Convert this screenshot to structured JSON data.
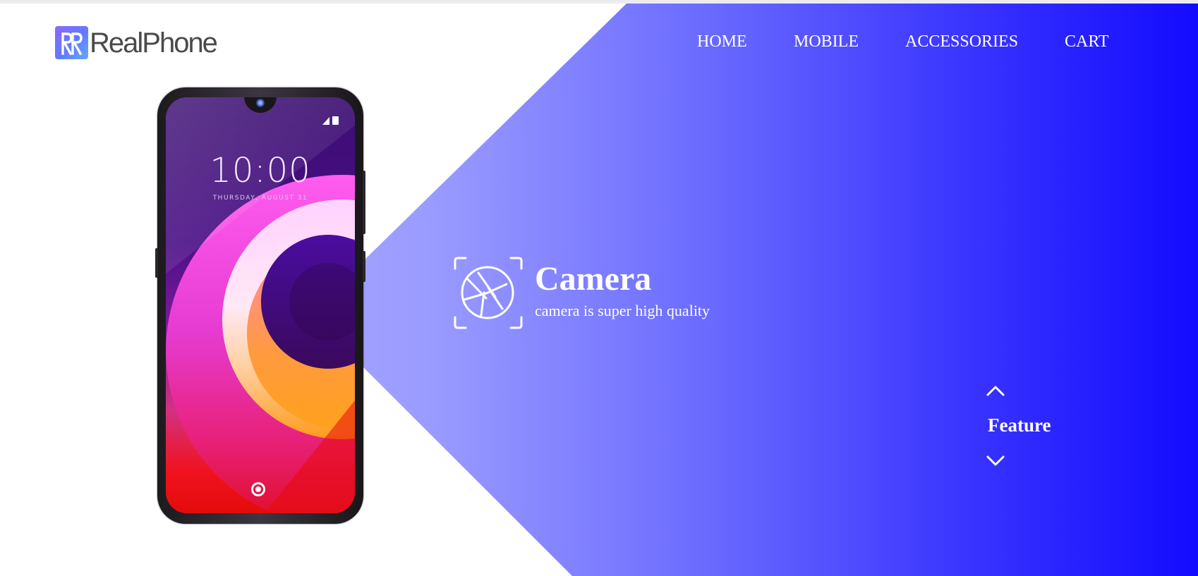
{
  "brand": {
    "name": "RealPhone",
    "logo_icon": "rr-monogram-icon"
  },
  "nav": {
    "items": [
      {
        "label": "HOME"
      },
      {
        "label": "MOBILE"
      },
      {
        "label": "ACCESSORIES"
      },
      {
        "label": "CART"
      }
    ]
  },
  "phone": {
    "time": "10:00",
    "date": "THURSDAY, AUGUST 31"
  },
  "feature": {
    "icon": "camera-aperture-icon",
    "title": "Camera",
    "description": "camera is super high quality"
  },
  "switcher": {
    "label": "Feature",
    "up_icon": "chevron-up-icon",
    "down_icon": "chevron-down-icon"
  },
  "colors": {
    "gradient_start": "#b8b9ff",
    "gradient_end": "#130bff",
    "text_on_accent": "#ffffff",
    "logo_text": "#4a4a4a"
  }
}
